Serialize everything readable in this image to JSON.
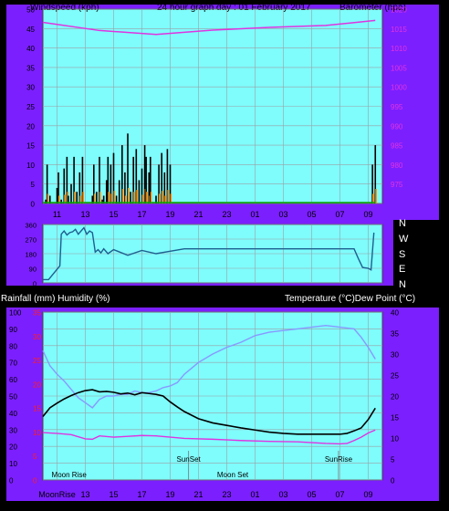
{
  "colors": {
    "frame": "#7b1fff",
    "plot_bg": "#7ffcfc",
    "grid": "#9aa0a6",
    "barometer": "#e033e0",
    "wind_gust": "#000000",
    "wind_avg_fill": "#ff8c00",
    "wind_low_fill": "#33cc33",
    "rain_line": "#00aa00",
    "direction": "#1f5f8f",
    "temperature": "#000000",
    "dew_point": "#e033e0",
    "humidity": "#8899ff",
    "sun_moon_marker": "#777777"
  },
  "header": {
    "left": "Windspeed (kph)",
    "center": "24 hour graph day : 01 February 2017",
    "right": "Barometer (hpa)"
  },
  "mid_header": {
    "left": "Rainfall (mm)  Humidity (%)",
    "right": "Temperature (°C)Dew Point (°C)"
  },
  "direction_letters": [
    "N",
    "W",
    "S",
    "E",
    "N"
  ],
  "x_ticks": [
    "11",
    "13",
    "15",
    "17",
    "19",
    "21",
    "23",
    "01",
    "03",
    "05",
    "07",
    "09"
  ],
  "bottom_x_ticks": [
    "13",
    "15",
    "17",
    "19",
    "21",
    "23",
    "01",
    "03",
    "05",
    "07",
    "09"
  ],
  "bottom_x_first": "MoonRise",
  "chart_data": [
    {
      "type": "line",
      "title": "Windspeed / Barometer",
      "ylabel": "Windspeed (kph)",
      "ylim": [
        0,
        50
      ],
      "yticks": [
        "0",
        "5",
        "10",
        "15",
        "20",
        "25",
        "30",
        "35",
        "40",
        "45",
        "50"
      ],
      "y2label": "Barometer (hpa)",
      "y2lim": [
        970,
        1020
      ],
      "y2ticks": [
        "975",
        "980",
        "985",
        "990",
        "995",
        "1000",
        "1005",
        "1010",
        "1015",
        "1020"
      ],
      "series": [
        {
          "name": "Barometer",
          "axis": "y2",
          "x": [
            0,
            4,
            8,
            12,
            16,
            20,
            23.5
          ],
          "values": [
            1016.6,
            1014.5,
            1013.5,
            1014.6,
            1015.3,
            1015.8,
            1017.1
          ]
        },
        {
          "name": "Windspeed",
          "x": [
            0.2,
            0.3,
            0.5,
            0.6,
            1.0,
            1.1,
            1.3,
            1.5,
            1.7,
            1.8,
            2.0,
            2.2,
            2.4,
            2.6,
            2.8,
            3.0,
            3.2,
            3.4,
            3.5,
            3.6,
            3.8,
            4.0,
            4.2,
            4.3,
            4.5,
            4.6,
            4.8,
            5.0,
            5.2,
            5.4,
            5.6,
            5.8,
            6.0,
            6.2,
            6.4,
            6.6,
            6.8,
            7.0,
            7.2,
            7.3,
            7.5,
            7.6,
            7.8,
            8.0,
            8.2,
            8.4,
            8.6,
            8.8,
            9.0,
            23.3,
            23.5
          ],
          "values": [
            1,
            10,
            2,
            0,
            4,
            8,
            1,
            9,
            12,
            2,
            5,
            12,
            3,
            8,
            12,
            0,
            0,
            0,
            2,
            10,
            3,
            12,
            1,
            2,
            6,
            12,
            10,
            13,
            2,
            6,
            15,
            8,
            18,
            3,
            12,
            14,
            6,
            9,
            15,
            12,
            8,
            12,
            0,
            2,
            10,
            13,
            8,
            14,
            10,
            10,
            15
          ]
        },
        {
          "name": "Rainfall",
          "x": [
            0,
            23.5
          ],
          "values": [
            0,
            0
          ]
        }
      ]
    },
    {
      "type": "line",
      "title": "Wind Direction",
      "ylim": [
        0,
        360
      ],
      "yticks": [
        "0",
        "90",
        "180",
        "270",
        "360"
      ],
      "series": [
        {
          "name": "Wind Direction",
          "x": [
            0,
            0.4,
            1.2,
            1.3,
            1.5,
            1.7,
            1.9,
            2.1,
            2.3,
            2.5,
            2.7,
            2.9,
            3.1,
            3.3,
            3.5,
            3.7,
            3.9,
            4.1,
            4.3,
            4.6,
            5.0,
            6.0,
            7.0,
            8.0,
            9.0,
            10.0,
            12.0,
            14.0,
            16.0,
            18.0,
            20.0,
            22.0,
            22.3,
            22.6,
            23.0,
            23.2,
            23.4
          ],
          "values": [
            20,
            20,
            105,
            300,
            320,
            295,
            310,
            315,
            330,
            300,
            320,
            340,
            300,
            320,
            310,
            190,
            205,
            185,
            210,
            180,
            205,
            170,
            200,
            180,
            195,
            210,
            210,
            210,
            210,
            210,
            210,
            210,
            150,
            95,
            90,
            80,
            310
          ]
        }
      ]
    },
    {
      "type": "line",
      "title": "Temperature / Humidity",
      "ylabel": "Rainfall (mm)  Humidity (%)",
      "ylim": [
        0,
        100
      ],
      "yticks": [
        "0",
        "10",
        "20",
        "30",
        "40",
        "50",
        "60",
        "70",
        "80",
        "90",
        "100"
      ],
      "y_red_ticks": [
        "0",
        "5",
        "10",
        "15",
        "20",
        "25",
        "30",
        "35"
      ],
      "y2label": "Temperature (°C)Dew Point (°C)",
      "y2lim": [
        0,
        40
      ],
      "y2ticks": [
        "0",
        "5",
        "10",
        "15",
        "20",
        "25",
        "30",
        "35",
        "40"
      ],
      "series": [
        {
          "name": "Humidity",
          "x": [
            0,
            0.5,
            1,
            1.5,
            2,
            2.5,
            3,
            3.5,
            4,
            4.5,
            5,
            5.5,
            6,
            6.5,
            7,
            7.5,
            8,
            8.5,
            9,
            9.5,
            10,
            11,
            12,
            13,
            14,
            15,
            16,
            17,
            18,
            19,
            20,
            21,
            22,
            22.5,
            23,
            23.5
          ],
          "values": [
            77,
            68,
            63,
            59,
            54,
            49,
            46,
            43,
            48,
            50,
            50,
            51,
            51,
            53,
            52,
            52,
            53,
            55,
            56,
            58,
            63,
            70,
            75,
            79,
            82,
            86,
            88,
            89,
            90,
            91,
            92,
            91,
            90,
            85,
            79,
            72
          ]
        },
        {
          "name": "Temperature",
          "x": [
            0,
            0.5,
            1,
            1.5,
            2,
            2.5,
            3,
            3.5,
            4,
            4.5,
            5,
            5.5,
            6,
            6.5,
            7,
            7.5,
            8,
            8.5,
            9,
            9.5,
            10,
            11,
            12,
            13,
            14,
            15,
            16,
            17,
            18,
            19,
            20,
            21,
            21.5,
            22,
            22.5,
            23,
            23.5
          ],
          "values": [
            15.1,
            17.2,
            18.3,
            19.3,
            20.1,
            20.8,
            21.3,
            21.5,
            21.0,
            21.1,
            20.9,
            20.5,
            20.7,
            20.3,
            20.8,
            20.6,
            20.4,
            20.0,
            18.6,
            17.4,
            16.3,
            14.6,
            13.6,
            13.0,
            12.4,
            11.9,
            11.4,
            11.1,
            10.9,
            10.9,
            10.9,
            10.9,
            11.1,
            11.7,
            12.4,
            14.4,
            17.1
          ]
        },
        {
          "name": "Dew Point",
          "x": [
            0,
            1,
            2,
            3,
            3.5,
            4,
            5,
            6,
            7,
            8,
            9,
            10,
            12,
            14,
            16,
            18,
            20,
            21,
            21.5,
            22,
            22.5,
            23,
            23.5
          ],
          "values": [
            11.3,
            11.1,
            10.8,
            9.8,
            9.7,
            10.5,
            10.2,
            10.4,
            10.6,
            10.5,
            10.2,
            9.9,
            9.7,
            9.4,
            9.2,
            9.1,
            8.7,
            8.6,
            8.7,
            9.4,
            10.2,
            11.2,
            11.9
          ]
        }
      ],
      "annotations": [
        {
          "label": "SunSet",
          "x": 10.3
        },
        {
          "label": "SunRise",
          "x": 20.9
        },
        {
          "label": "Moon Rise",
          "x": 0.1
        },
        {
          "label": "Moon Set",
          "x": 11.8
        }
      ]
    }
  ]
}
